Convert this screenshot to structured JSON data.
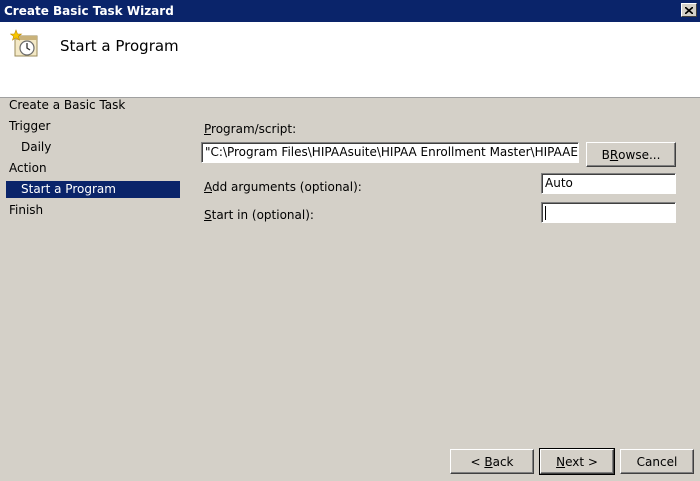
{
  "window": {
    "title": "Create Basic Task Wizard"
  },
  "header": {
    "heading": "Start a Program"
  },
  "nav": {
    "items": [
      {
        "label": "Create a Basic Task"
      },
      {
        "label": "Trigger"
      },
      {
        "label": "Daily"
      },
      {
        "label": "Action"
      },
      {
        "label": "Start a Program"
      },
      {
        "label": "Finish"
      }
    ]
  },
  "form": {
    "program_label_key": "P",
    "program_label_rest": "rogram/script:",
    "program_value": "\"C:\\Program Files\\HIPAAsuite\\HIPAA Enrollment Master\\HIPAAEnrollr",
    "browse_key": "R",
    "browse_rest_before": "B",
    "browse_rest_after": "owse...",
    "args_label_key": "A",
    "args_label_rest": "dd arguments (optional):",
    "args_value": "Auto",
    "startin_label_key": "S",
    "startin_label_rest": "tart in (optional):",
    "startin_value": ""
  },
  "footer": {
    "back_prefix": "< ",
    "back_key": "B",
    "back_rest": "ack",
    "next_key": "N",
    "next_rest": "ext >",
    "cancel_label": "Cancel"
  }
}
